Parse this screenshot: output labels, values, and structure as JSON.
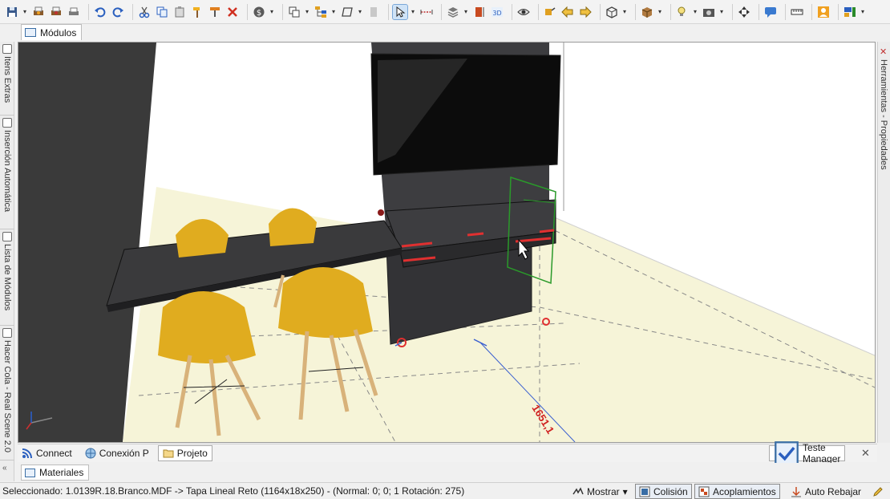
{
  "toolbar": {
    "icons": [
      "save-icon",
      "print-icon",
      "print-icon",
      "print-preview-icon",
      "undo-icon",
      "redo-icon",
      "cut-icon",
      "copy-icon",
      "paste-icon",
      "hammer-icon",
      "format-painter-icon",
      "delete-icon",
      "money-icon",
      "duplicate-icon",
      "hierarchy-icon",
      "shape-icon",
      "page-icon",
      "pointer-icon",
      "measure-icon",
      "layers-icon",
      "dimension-icon",
      "3d-icon",
      "eye-icon",
      "cube-link-icon",
      "arrow-left-icon",
      "arrow-right-icon",
      "view-icon",
      "box-icon",
      "lamp-icon",
      "camera-icon",
      "move-icon",
      "chat-icon",
      "ruler-icon",
      "user-icon",
      "layout-icon"
    ]
  },
  "tabs": {
    "modulos": "Módulos",
    "materiales": "Materiales"
  },
  "left_panel": {
    "tabs": [
      "Itens Extras",
      "Inserción Automática",
      "Lista de Módulos",
      "Hacer Cola - Real Scene 2.0"
    ]
  },
  "right_panel": {
    "label": "Herramientas - Propiedades"
  },
  "viewport": {
    "dimension_label": "1651,1",
    "colors": {
      "wall_dark": "#3a3a3a",
      "floor": "#f6f4d8",
      "furniture": "#3d3d40",
      "chair": "#e0ac1f",
      "selection_green": "#2a9a2a",
      "dimension_red": "#e03030",
      "dimension_blue": "#3a5fd0"
    }
  },
  "bottom_tabs": {
    "items": [
      {
        "label": "Connect",
        "icon": "rss-icon"
      },
      {
        "label": "Conexión P",
        "icon": "globe-icon"
      },
      {
        "label": "Projeto",
        "icon": "folder-icon"
      }
    ],
    "teste_manager": "Teste Manager"
  },
  "status": {
    "text": "Seleccionado: 1.0139R.18.Branco.MDF -> Tapa Lineal Reto (1164x18x250) - (Normal: 0; 0; 1 Rotación: 275)",
    "mostrar": "Mostrar",
    "colision": "Colisión",
    "acoplamientos": "Acoplamientos",
    "auto_rebajar": "Auto Rebajar"
  }
}
